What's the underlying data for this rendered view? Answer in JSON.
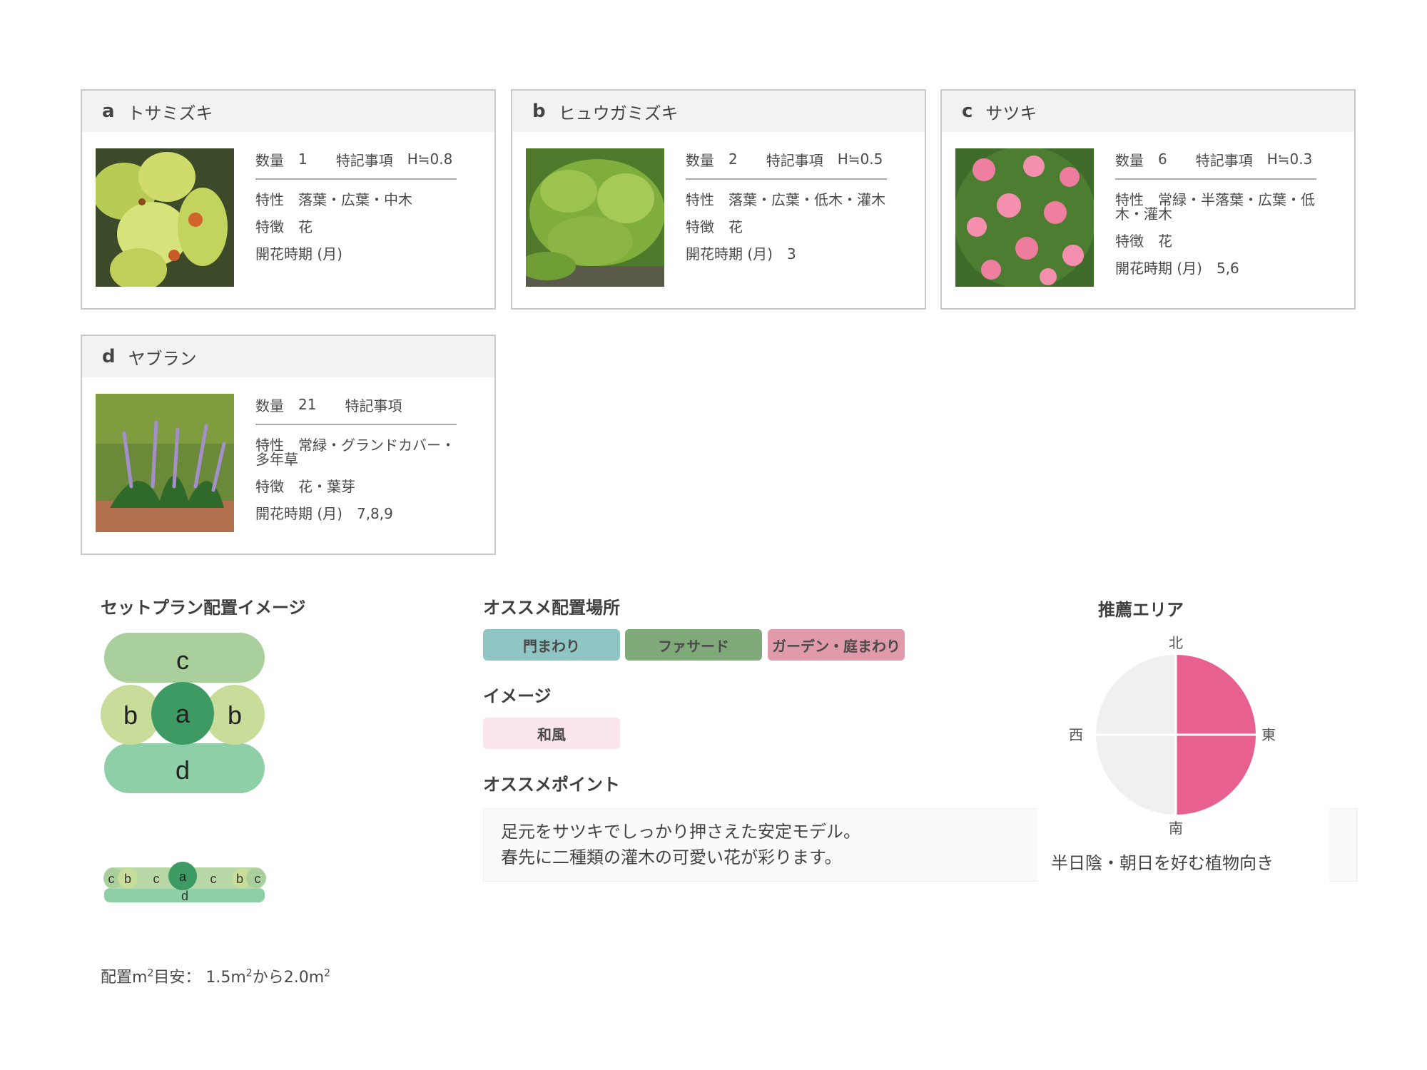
{
  "plants": [
    {
      "letter": "a",
      "name": "トサミズキ",
      "qty_label": "数量",
      "qty": "1",
      "note_label": "特記事項",
      "note": "H≒0.8",
      "trait_label": "特性",
      "trait": "落葉・広葉・中木",
      "feature_label": "特徴",
      "feature": "花",
      "bloom_label": "開花時期 (月)",
      "bloom": ""
    },
    {
      "letter": "b",
      "name": "ヒュウガミズキ",
      "qty_label": "数量",
      "qty": "2",
      "note_label": "特記事項",
      "note": "H≒0.5",
      "trait_label": "特性",
      "trait": "落葉・広葉・低木・灌木",
      "feature_label": "特徴",
      "feature": "花",
      "bloom_label": "開花時期 (月)",
      "bloom": "3"
    },
    {
      "letter": "c",
      "name": "サツキ",
      "qty_label": "数量",
      "qty": "6",
      "note_label": "特記事項",
      "note": "H≒0.3",
      "trait_label": "特性",
      "trait": "常緑・半落葉・広葉・低木・灌木",
      "feature_label": "特徴",
      "feature": "花",
      "bloom_label": "開花時期 (月)",
      "bloom": "5,6"
    },
    {
      "letter": "d",
      "name": "ヤブラン",
      "qty_label": "数量",
      "qty": "21",
      "note_label": "特記事項",
      "note": "",
      "trait_label": "特性",
      "trait": "常緑・グランドカバー・多年草",
      "feature_label": "特徴",
      "feature": "花・葉芽",
      "bloom_label": "開花時期 (月)",
      "bloom": "7,8,9"
    }
  ],
  "layout_section": {
    "title": "セットプラン配置イメージ",
    "big_labels": [
      "c",
      "b",
      "a",
      "b",
      "d"
    ],
    "strip_labels": [
      "c",
      "b",
      "c",
      "a",
      "c",
      "b",
      "c",
      "d"
    ],
    "area_note": {
      "prefix": "配置m",
      "sup1": "2",
      "mid": "目安： 1.5m",
      "sup2": "2",
      "mid2": "から2.0m",
      "sup3": "2"
    }
  },
  "recommend": {
    "title": "オススメ配置場所",
    "tags": [
      {
        "label": "門まわり",
        "color": "#8fc6c4"
      },
      {
        "label": "ファサード",
        "color": "#7fa978"
      },
      {
        "label": "ガーデン・庭まわり",
        "color": "#e09aa9"
      }
    ],
    "image_title": "イメージ",
    "image_tag": {
      "label": "和風",
      "color": "#fce6ee"
    },
    "point_title": "オススメポイント",
    "point_lines": [
      "足元をサツキでしっかり押さえた安定モデル。",
      "春先に二種類の灌木の可愛い花が彩ります。"
    ]
  },
  "area": {
    "title": "推薦エリア",
    "north": "北",
    "east": "東",
    "south": "南",
    "west": "西",
    "active_quadrants": [
      "north-east",
      "south-east"
    ],
    "active_color": "#e8608f",
    "inactive_color": "#f0f0f0",
    "caption": "半日陰・朝日を好む植物向き"
  }
}
